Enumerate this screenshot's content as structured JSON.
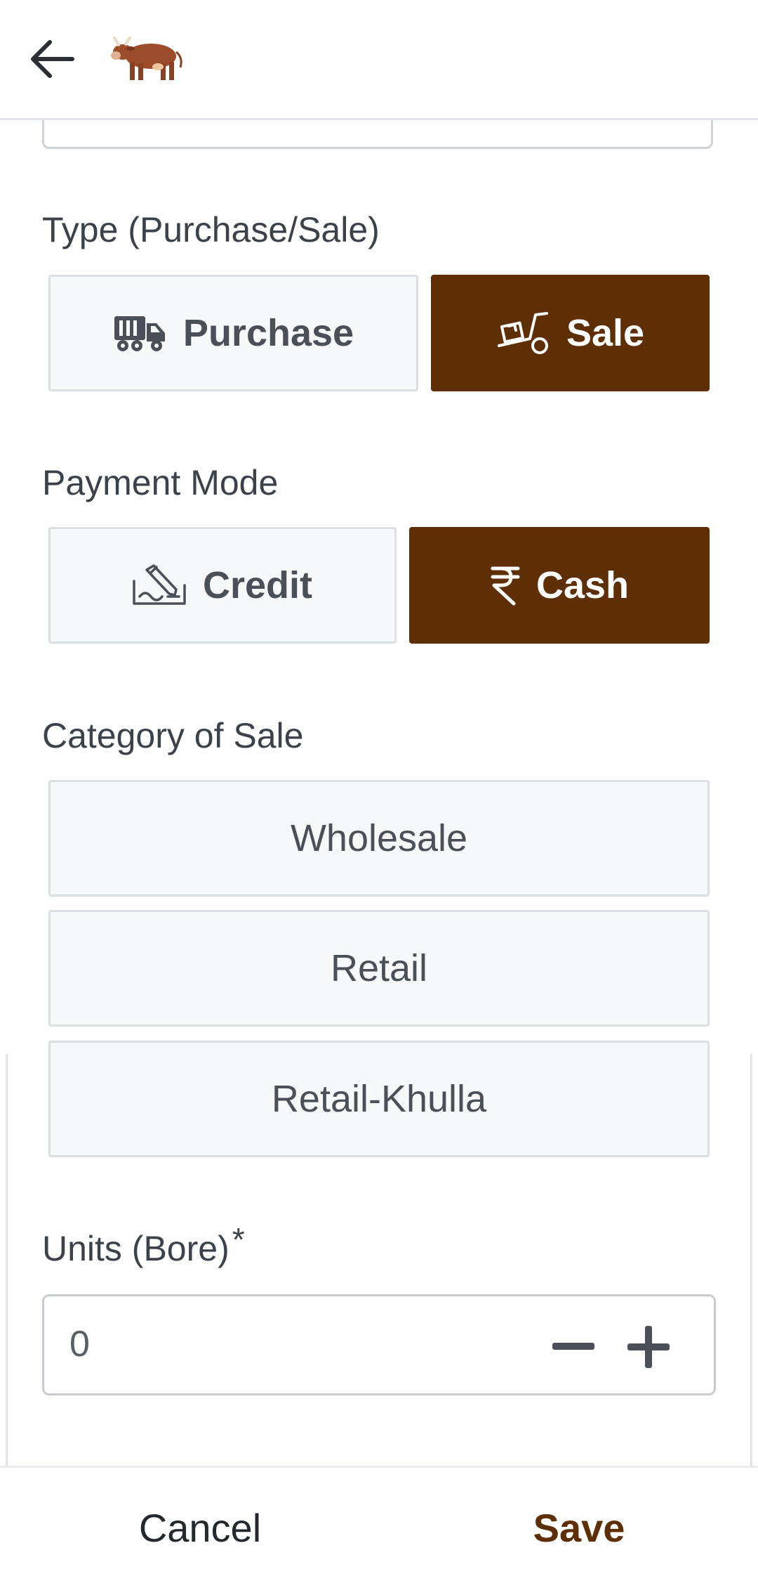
{
  "header": {
    "back_icon": "arrow-left-icon",
    "logo_icon": "cow-logo-icon"
  },
  "type_section": {
    "label": "Type (Purchase/Sale)",
    "options": [
      {
        "label": "Purchase",
        "icon": "delivery-truck-icon",
        "selected": false
      },
      {
        "label": "Sale",
        "icon": "hand-truck-icon",
        "selected": true
      }
    ]
  },
  "payment_section": {
    "label": "Payment Mode",
    "options": [
      {
        "label": "Credit",
        "icon": "signature-icon",
        "selected": false
      },
      {
        "label": "Cash",
        "icon": "rupee-icon",
        "selected": true
      }
    ]
  },
  "category_section": {
    "label": "Category of Sale",
    "options": [
      {
        "label": "Wholesale",
        "selected": false
      },
      {
        "label": "Retail",
        "selected": false
      },
      {
        "label": "Retail-Khulla",
        "selected": false
      }
    ]
  },
  "units_section": {
    "label": "Units (Bore)",
    "required_mark": "*",
    "value": "0",
    "decrement_icon": "minus-icon",
    "increment_icon": "plus-icon"
  },
  "footer": {
    "cancel_label": "Cancel",
    "save_label": "Save"
  },
  "colors": {
    "accent": "#5e2e05",
    "option_bg": "#f7f8fa",
    "option_border": "#dcdfe3"
  }
}
